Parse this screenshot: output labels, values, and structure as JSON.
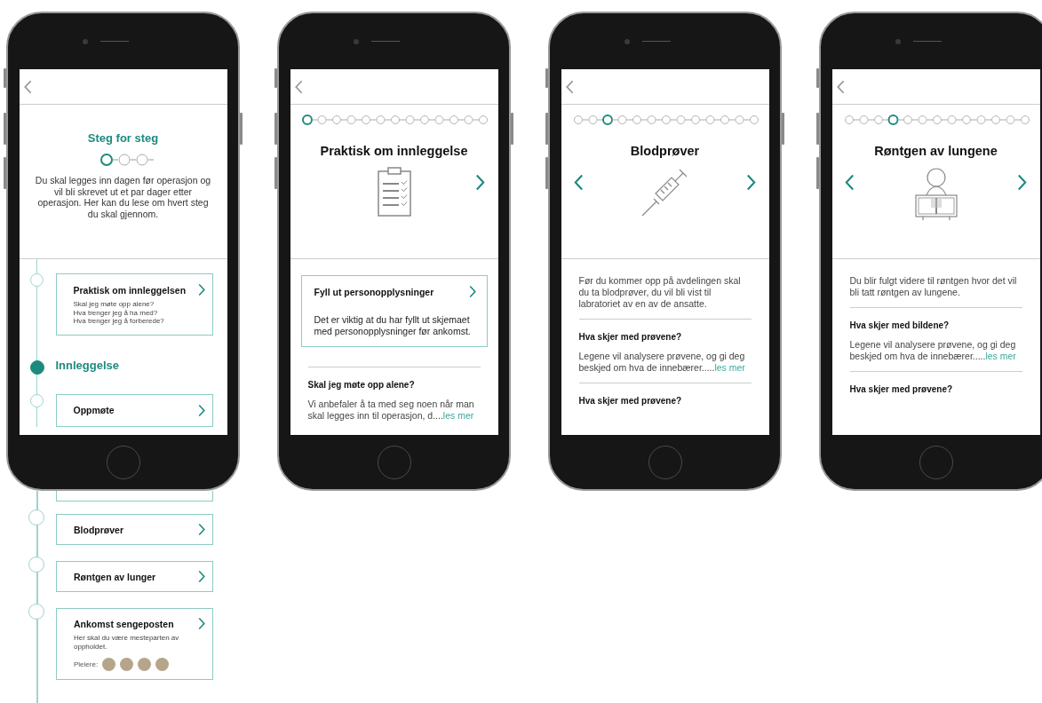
{
  "phones": [
    {
      "kind": "overview",
      "title": "Steg for steg",
      "stepper": [
        {
          "selected": true
        },
        {
          "selected": false
        },
        {
          "selected": false
        }
      ],
      "intro": "Du skal legges inn dagen før operasjon og vil bli skrevet ut et par dager etter operasjon. Her kan du lese om hvert steg du skal gjennom.",
      "timeline": [
        {
          "kind": "card",
          "title": "Praktisk om innleggelsen",
          "lines": [
            "Skal jeg møte opp alene?",
            "Hva trenger jeg å ha med?",
            "Hva trenger jeg å forberede?"
          ]
        },
        {
          "kind": "section",
          "title": "Innleggelse"
        },
        {
          "kind": "card",
          "title": "Oppmøte"
        }
      ],
      "below_frame": [
        {
          "kind": "card",
          "title": "Blodprøver"
        },
        {
          "kind": "card",
          "title": "Røntgen av lunger"
        },
        {
          "kind": "card",
          "title": "Ankomst sengeposten",
          "lines": [
            "Her skal du være mesteparten av oppholdet."
          ],
          "staff": {
            "label": "Pleiere:",
            "avatars": [
              {
                "kind": "photo"
              },
              {
                "kind": "photo"
              },
              {
                "kind": "photo"
              },
              {
                "kind": "photo"
              }
            ]
          }
        }
      ]
    },
    {
      "kind": "detail",
      "progress": [
        {
          "selected": true
        },
        {
          "selected": false
        },
        {
          "selected": false
        },
        {
          "selected": false
        },
        {
          "selected": false
        },
        {
          "selected": false
        },
        {
          "selected": false
        },
        {
          "selected": false
        },
        {
          "selected": false
        },
        {
          "selected": false
        },
        {
          "selected": false
        },
        {
          "selected": false
        },
        {
          "selected": false
        }
      ],
      "title": "Praktisk om innleggelse",
      "prev": false,
      "next": true,
      "illustration": {
        "kind": "clipboard"
      },
      "content": [
        {
          "kind": "card",
          "title": "Fyll ut personopplysninger",
          "text": "Det er viktig at du har fyllt ut skjemaet med personopplysninger før ankomst."
        },
        {
          "kind": "divider"
        },
        {
          "kind": "heading",
          "text": "Skal jeg møte opp alene?"
        },
        {
          "kind": "text",
          "text": "Vi anbefaler å ta med seg noen når man skal legges inn til operasjon, d....",
          "link": "les mer"
        }
      ]
    },
    {
      "kind": "detail",
      "progress": [
        {
          "selected": false
        },
        {
          "selected": false
        },
        {
          "selected": true
        },
        {
          "selected": false
        },
        {
          "selected": false
        },
        {
          "selected": false
        },
        {
          "selected": false
        },
        {
          "selected": false
        },
        {
          "selected": false
        },
        {
          "selected": false
        },
        {
          "selected": false
        },
        {
          "selected": false
        },
        {
          "selected": false
        }
      ],
      "title": "Blodprøver",
      "prev": true,
      "next": true,
      "illustration": {
        "kind": "syringe"
      },
      "content": [
        {
          "kind": "text",
          "text": "Før du kommer opp på avdelingen skal du ta blodprøver, du vil bli vist til labratoriet av en av de ansatte."
        },
        {
          "kind": "divider"
        },
        {
          "kind": "heading",
          "text": "Hva skjer med prøvene?"
        },
        {
          "kind": "text",
          "text": "Legene vil analysere prøvene, og gi deg beskjed om hva de innebærer.....",
          "link": "les mer"
        },
        {
          "kind": "divider"
        },
        {
          "kind": "heading",
          "text": "Hva skjer med prøvene?"
        }
      ]
    },
    {
      "kind": "detail",
      "progress": [
        {
          "selected": false
        },
        {
          "selected": false
        },
        {
          "selected": false
        },
        {
          "selected": true
        },
        {
          "selected": false
        },
        {
          "selected": false
        },
        {
          "selected": false
        },
        {
          "selected": false
        },
        {
          "selected": false
        },
        {
          "selected": false
        },
        {
          "selected": false
        },
        {
          "selected": false
        },
        {
          "selected": false
        }
      ],
      "title": "Røntgen av lungene",
      "prev": true,
      "next": true,
      "illustration": {
        "kind": "xray"
      },
      "content": [
        {
          "kind": "text",
          "text": "Du blir fulgt videre til røntgen hvor det vil bli tatt røntgen av lungene."
        },
        {
          "kind": "divider"
        },
        {
          "kind": "heading",
          "text": "Hva skjer med bildene?"
        },
        {
          "kind": "text",
          "text": "Legene vil analysere prøvene, og gi deg beskjed om hva de innebærer.....",
          "link": "les mer"
        },
        {
          "kind": "divider"
        },
        {
          "kind": "heading",
          "text": "Hva skjer med prøvene?"
        }
      ]
    }
  ]
}
